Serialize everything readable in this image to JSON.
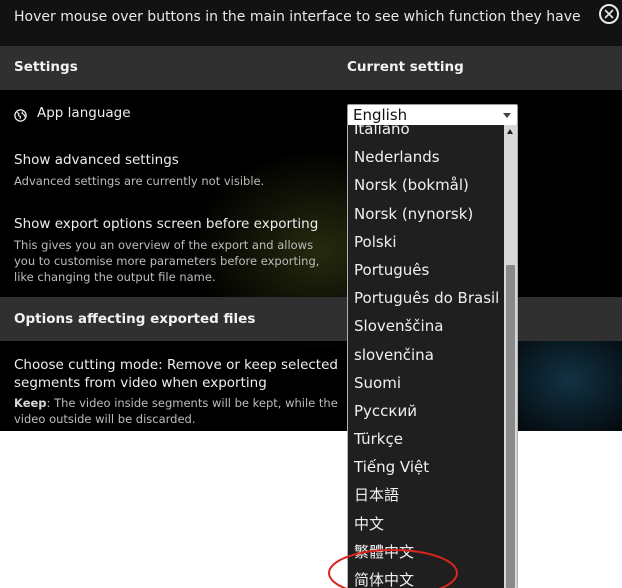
{
  "window": {
    "hint_text": "Hover mouse over buttons in the main interface to see which function they have"
  },
  "settings_header": {
    "col_settings": "Settings",
    "col_current": "Current setting"
  },
  "app_language": {
    "label": "App language",
    "selected_value": "English",
    "icon": "globe-icon"
  },
  "advanced": {
    "title": "Show advanced settings",
    "description": "Advanced settings are currently not visible."
  },
  "export_screen": {
    "title": "Show export options screen before exporting",
    "description_line1": "This gives you an overview of the export and allows",
    "description_line2": "you to customise more parameters before exporting,",
    "description_line3": "like changing the output file name."
  },
  "export_section": {
    "title": "Options affecting exported files"
  },
  "cutting_mode": {
    "title_line1": "Choose cutting mode: Remove or keep selected",
    "title_line2": "segments from video when exporting",
    "keep_label": "Keep",
    "keep_desc_line1": ": The video inside segments will be kept, while the",
    "keep_desc_line2": "video outside will be discarded."
  },
  "language_options": [
    "Italiano",
    "Nederlands",
    "Norsk (bokmål)",
    "Norsk (nynorsk)",
    "Polski",
    "Português",
    "Português do Brasil",
    "Slovenščina",
    "slovenčina",
    "Suomi",
    "Русский",
    "Türkçe",
    "Tiếng Việt",
    "日本語",
    "中文",
    "繁體中文",
    "简体中文"
  ],
  "colors": {
    "background": "#000000",
    "section_header": "#303030",
    "dropdown_bg": "#1f1f1f",
    "annotation": "#d9261c"
  }
}
